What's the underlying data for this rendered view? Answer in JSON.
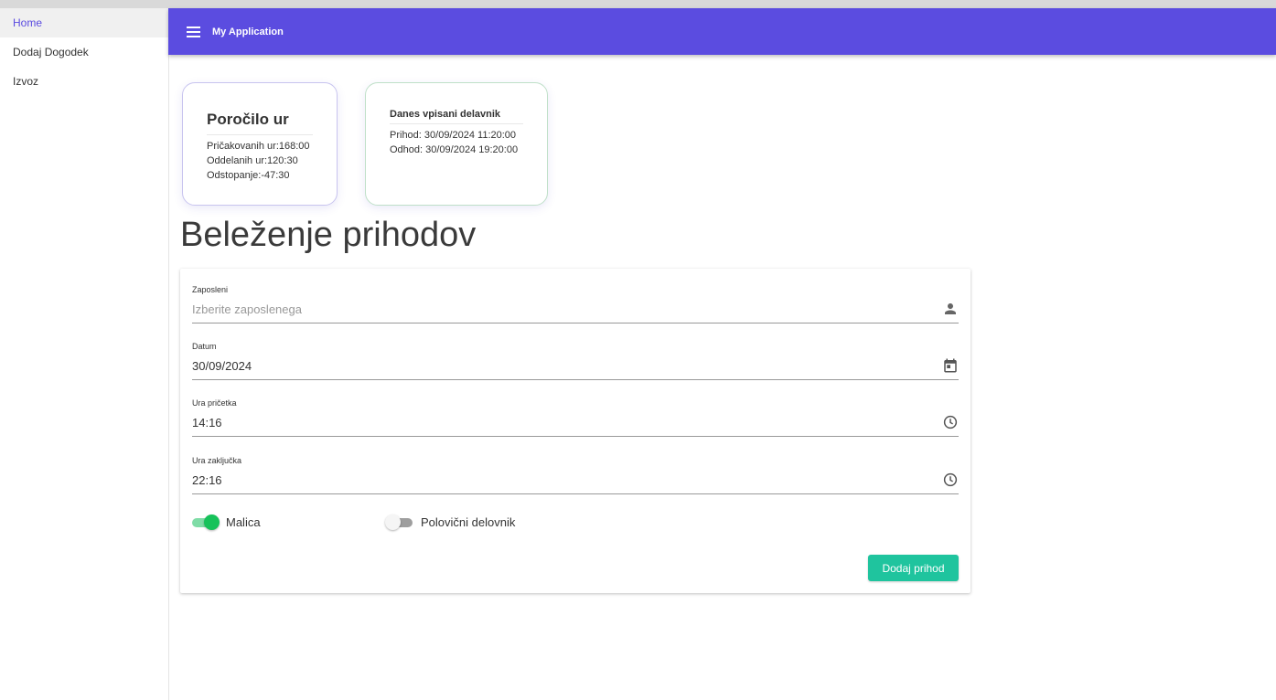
{
  "sidebar": {
    "items": [
      {
        "label": "Home"
      },
      {
        "label": "Dodaj Dogodek"
      },
      {
        "label": "Izvoz"
      }
    ]
  },
  "appbar": {
    "menu_icon": "hamburger-menu-icon",
    "title": "My Application"
  },
  "report_card": {
    "title": "Poročilo ur",
    "lines": [
      "Pričakovanih ur:168:00",
      "Oddelanih ur:120:30",
      "Odstopanje:-47:30"
    ]
  },
  "today_card": {
    "title": "Danes vpisani delavnik",
    "lines": [
      "Prihod: 30/09/2024 11:20:00",
      "Odhod: 30/09/2024 19:20:00"
    ]
  },
  "page_title": "Beleženje prihodov",
  "form": {
    "employee": {
      "label": "Zaposleni",
      "placeholder": "Izberite zaposlenega",
      "icon": "person-icon"
    },
    "date": {
      "label": "Datum",
      "value": "30/09/2024",
      "icon": "calendar-icon"
    },
    "start_time": {
      "label": "Ura pričetka",
      "value": "14:16",
      "icon": "clock-icon"
    },
    "end_time": {
      "label": "Ura zaključka",
      "value": "22:16",
      "icon": "clock-icon"
    },
    "toggles": [
      {
        "label": "Malica",
        "on": true
      },
      {
        "label": "Polovični delovnik",
        "on": false
      }
    ],
    "submit_label": "Dodaj prihod"
  },
  "colors": {
    "primary": "#5b4ce0",
    "accent_green": "#1fc49e",
    "toggle_on": "#16c25a"
  }
}
